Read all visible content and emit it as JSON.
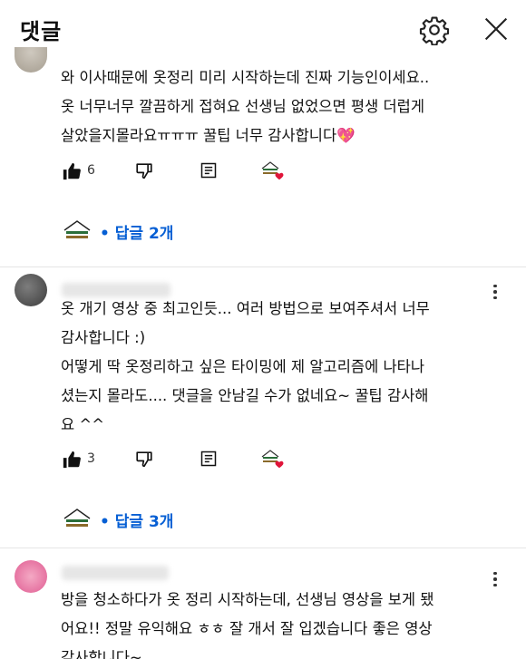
{
  "header": {
    "title": "댓글",
    "settings_icon": "gear-icon",
    "close_icon": "close-icon"
  },
  "colors": {
    "link_blue": "#065fd4",
    "heart_red": "#e0153a",
    "text": "#0f0f0f"
  },
  "comments": [
    {
      "lines": [
        "와 이사때문에 옷정리 미리 시작하는데 진짜 기능인이세요..",
        "옷 너무너무 깔끔하게 접혀요 선생님 없었으면 평생 더럽게",
        "살았을지몰라요ㅠㅠㅠ 꿀팁 너무 감사합니다💖"
      ],
      "like_count": "6",
      "replies_label": "• 답글 2개"
    },
    {
      "lines": [
        "옷 개기 영상 중 최고인듯... 여러 방법으로 보여주셔서 너무",
        "감사합니다 :)",
        "어떻게 딱 옷정리하고 싶은 타이밍에 제 알고리즘에 나타나",
        "셨는지 몰라도.... 댓글을 안남길 수가 없네요~ 꿀팁 감사해",
        "요 ^^"
      ],
      "like_count": "3",
      "replies_label": "• 답글 3개"
    },
    {
      "lines": [
        "방을 청소하다가 옷 정리 시작하는데, 선생님 영상을 보게 됐",
        "어요!! 정말 유익해요 ㅎㅎ 잘 개서 잘 입겠습니다 좋은 영상",
        "감사합니다~"
      ]
    }
  ]
}
